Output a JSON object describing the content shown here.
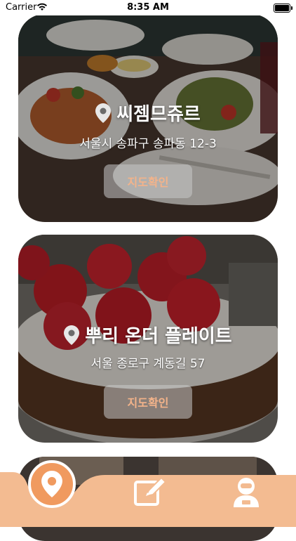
{
  "status": {
    "carrier": "Carrier",
    "time": "8:35 AM"
  },
  "cards": [
    {
      "name": "씨젬므쥬르",
      "address": "서울시 송파구 송파동 12-3",
      "button": "지도확인"
    },
    {
      "name": "뿌리 온더 플레이트",
      "address": "서울 종로구 계동길 57",
      "button": "지도확인"
    }
  ],
  "tabs": [
    {
      "icon": "map-pin-icon",
      "active": true
    },
    {
      "icon": "edit-icon",
      "active": false
    },
    {
      "icon": "profile-icon",
      "active": false
    }
  ],
  "colors": {
    "accent": "#f09a5f",
    "tabbar": "#f3bb91",
    "button_text": "#f3b38a"
  }
}
